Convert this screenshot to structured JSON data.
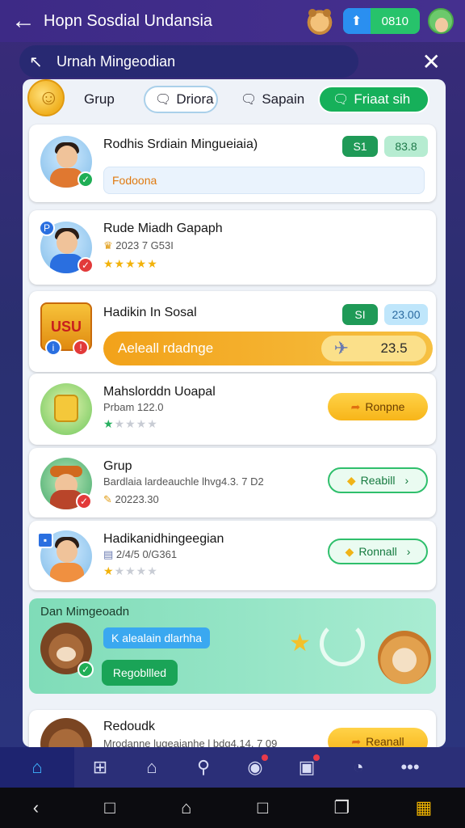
{
  "topbar": {
    "back_icon": "arrow-left-icon",
    "title": "Hopn Sosdial Undansia",
    "score": "0810"
  },
  "subbar": {
    "title": "Urnah Mingeodian"
  },
  "tabs": [
    {
      "label": "Grup"
    },
    {
      "label": "Driora"
    },
    {
      "label": "Sapain"
    },
    {
      "label": "Friaat sih"
    }
  ],
  "items": [
    {
      "name": "Rodhis Srdiain Mingueiaia)",
      "chip1": "S1",
      "chip2": "83.8",
      "input": "Fodoona"
    },
    {
      "name": "Rude Miadh Gapaph",
      "meta": "2023 7 G53I",
      "stars_on": 5
    },
    {
      "name": "Hadikin In Sosal",
      "chip1": "SI",
      "chip2": "23.00",
      "bar_label": "Aeleall rdadnge",
      "bar_value": "23.5",
      "logo": "USU"
    },
    {
      "name": "Mahslorddn Uoapal",
      "meta": "Prbam 122.0",
      "stars_on": 1,
      "button": "Ronpne"
    },
    {
      "name": "Grup",
      "meta": "Bardlaia lardeauchle lhvg4.3. 7 D2",
      "meta2": "20223.30",
      "button": "Reabill"
    },
    {
      "name": "Hadikanidhingeegian",
      "meta": "2/4/5 0/G361",
      "stars_on": 1,
      "button": "Ronnall"
    }
  ],
  "feature": {
    "title": "Dan Mimgeoadn",
    "pill": "K alealain dlarhha",
    "button": "Regobllled"
  },
  "last_item": {
    "name": "Redoudk",
    "meta": "Mrodanne lugeaianhe l bdg4.14. 7 09",
    "button": "Reanall"
  },
  "colors": {
    "accent_green": "#16b05a",
    "accent_orange": "#f2a21a",
    "nav_bg": "#2b2f78"
  }
}
